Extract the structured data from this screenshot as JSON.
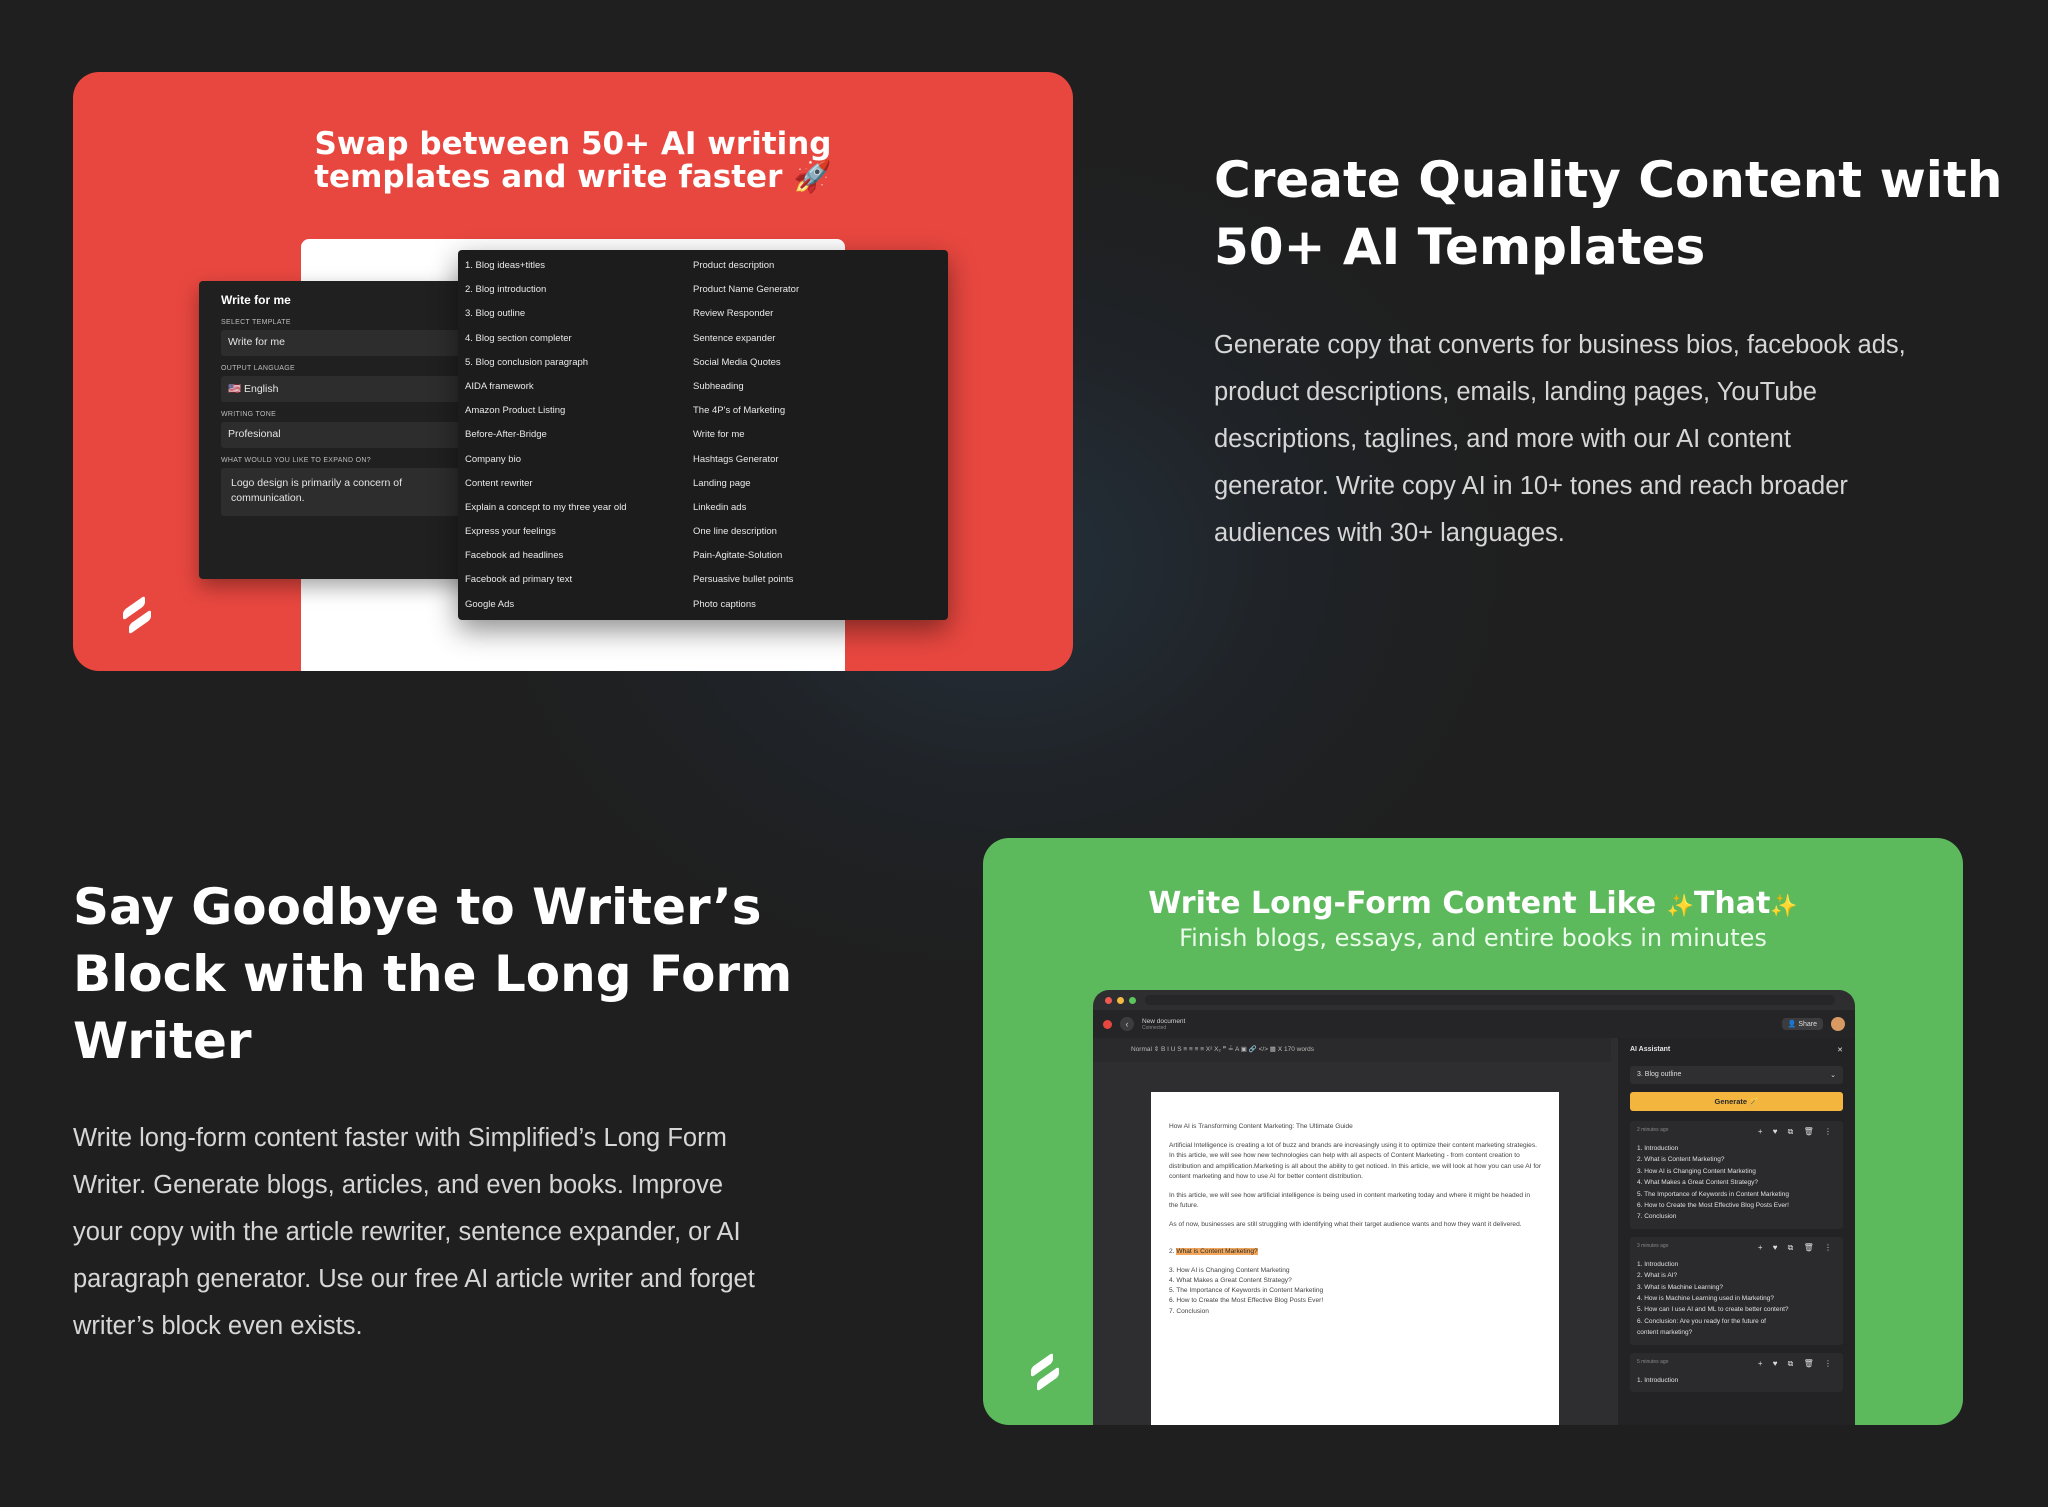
{
  "section1": {
    "card": {
      "title_line1": "Swap between 50+ AI writing",
      "title_line2": "templates and write faster",
      "title_emoji": "🚀",
      "form": {
        "title": "Write for me",
        "template_label": "SELECT TEMPLATE",
        "template_value": "Write for me",
        "language_label": "OUTPUT LANGUAGE",
        "language_value": "🇺🇸 English",
        "tone_label": "WRITING TONE",
        "tone_value": "Profesional",
        "expand_label": "WHAT WOULD YOU LIKE TO EXPAND ON?",
        "expand_value": "Logo design is primarily a concern of communication."
      },
      "menu_left": [
        "1. Blog ideas+titles",
        "2. Blog introduction",
        "3. Blog outline",
        "4. Blog section completer",
        "5. Blog conclusion paragraph",
        "AIDA framework",
        "Amazon Product Listing",
        "Before-After-Bridge",
        "Company bio",
        "Content rewriter",
        "Explain a concept to my three year old",
        "Express your feelings",
        "Facebook ad headlines",
        "Facebook ad primary text",
        "Google Ads"
      ],
      "menu_right": [
        "Product description",
        "Product Name Generator",
        "Review Responder",
        "Sentence expander",
        "Social Media Quotes",
        "Subheading",
        "The 4P's of Marketing",
        "Write for me",
        "Hashtags Generator",
        "Landing page",
        "Linkedin ads",
        "One line description",
        "Pain-Agitate-Solution",
        "Persuasive bullet points",
        "Photo captions"
      ]
    },
    "heading_line1": "Create Quality Content with",
    "heading_line2": "50+ AI Templates",
    "paragraph": [
      "Generate copy that converts for business bios, facebook ads,",
      "product descriptions, emails, landing pages, YouTube",
      "descriptions, taglines, and more with our AI content",
      "generator. Write copy AI in 10+ tones and reach broader",
      "audiences with 30+ languages."
    ]
  },
  "section2": {
    "heading_line1": "Say Goodbye to Writer’s",
    "heading_line2": "Block with the Long Form",
    "heading_line3": "Writer",
    "paragraph": [
      "Write long-form content faster with Simplified’s Long Form",
      "Writer. Generate blogs, articles, and even books. Improve",
      "your copy with the article rewriter, sentence expander, or AI",
      "paragraph generator. Use our free AI article writer and forget",
      "writer’s block even exists."
    ],
    "card": {
      "title_a": "Write Long-Form Content Like",
      "title_b": "That",
      "sparkle": "✨",
      "subtitle": "Finish blogs, essays, and entire books in minutes",
      "editor": {
        "doc_name": "New document",
        "doc_status": "Connected",
        "back": "‹",
        "share": "👤 Share",
        "toolbar": "Normal      ⇕     B  I  U  S      ≡  ≡  ≡  ≡      X²  X₂  ❞      ≟  A  ▣      🔗  </>  ▦      Ⅹ      170 words",
        "doc_title": "How AI is Transforming Content Marketing: The Ultimate Guide",
        "p1": "Artificial Intelligence is creating a lot of buzz and brands are increasingly using it to optimize their content marketing strategies. In this article, we will see how new technologies can help with all aspects of Content Marketing - from content creation to distribution and amplification.Marketing is all about the ability to get noticed. In this article, we will look at how you can use AI for content marketing and how to use AI for better content distribution.",
        "p2": "In this article, we will see how artificial intelligence is being used in content marketing today and where it might be headed in the future.",
        "p3": "As of now, businesses are still struggling with identifying what their target audience wants and how they want it delivered.",
        "outline_num": "2. ",
        "outline_highlight": "What is Content Marketing?",
        "outline": [
          "3. How AI is Changing Content Marketing",
          "4. What Makes a Great Content Strategy?",
          "5. The Importance of Keywords in Content Marketing",
          "6. How to Create the Most Effective Blog Posts Ever!",
          "7. Conclusion"
        ]
      },
      "assistant": {
        "title": "AI Assistant",
        "close": "✕",
        "select_value": "3. Blog outline",
        "select_arrow": "⌄",
        "generate": "Generate 🪄",
        "icons": "+ ♥ ⧉ 🗑 ⋮",
        "result1_time": "2 minutes ago",
        "result1": [
          "1. Introduction",
          "2. What is Content Marketing?",
          "3. How AI is Changing Content Marketing",
          "4. What Makes a Great Content Strategy?",
          "5. The Importance of Keywords in Content Marketing",
          "6. How to Create the Most Effective Blog Posts Ever!",
          "7. Conclusion"
        ],
        "result2_time": "3 minutes ago",
        "result2": [
          "1. Introduction",
          "2. What is AI?",
          "3. What is Machine Learning?",
          "4. How is Machine Learning used in Marketing?",
          "5. How can I use AI and ML to create better content?",
          "6. Conclusion: Are you ready for the future of",
          "content marketing?"
        ],
        "result3_time": "5 minutes ago",
        "result3": [
          "1. Introduction"
        ]
      }
    }
  },
  "colors": {
    "background": "#1f1f1f",
    "red_card": "#e8473f",
    "green_card": "#5cba5c",
    "generate_button": "#f3b53d"
  }
}
